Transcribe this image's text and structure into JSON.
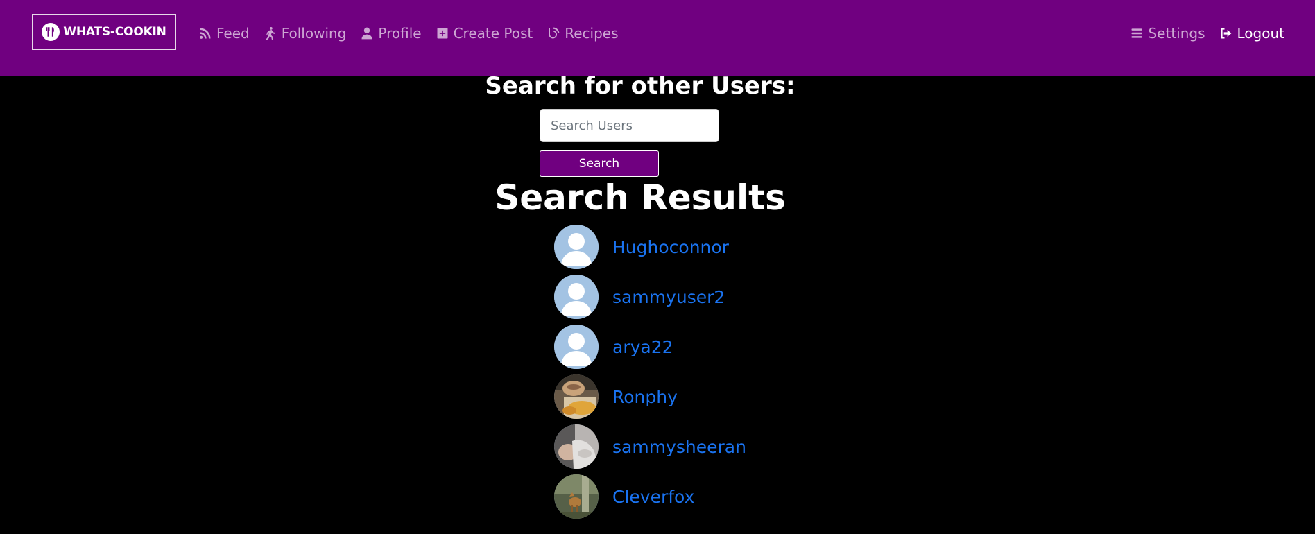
{
  "brand": {
    "logo_text": "WHATS-COOKIN"
  },
  "nav": {
    "left": [
      {
        "label": "Feed",
        "icon": "rss-icon"
      },
      {
        "label": "Following",
        "icon": "walking-icon"
      },
      {
        "label": "Profile",
        "icon": "user-icon"
      },
      {
        "label": "Create Post",
        "icon": "plus-square-icon"
      },
      {
        "label": "Recipes",
        "icon": "blog-icon"
      }
    ],
    "right": [
      {
        "label": "Settings",
        "icon": "bars-icon"
      },
      {
        "label": "Logout",
        "icon": "sign-out-icon"
      }
    ]
  },
  "search": {
    "title": "Search for other Users:",
    "placeholder": "Search Users",
    "value": "",
    "button_label": "Search"
  },
  "results": {
    "title": "Search Results",
    "items": [
      {
        "username": "Hughoconnor",
        "avatar": "default-avatar"
      },
      {
        "username": "sammyuser2",
        "avatar": "default-avatar"
      },
      {
        "username": "arya22",
        "avatar": "default-avatar"
      },
      {
        "username": "Ronphy",
        "avatar": "photo-avatar"
      },
      {
        "username": "sammysheeran",
        "avatar": "photo-avatar"
      },
      {
        "username": "Cleverfox",
        "avatar": "photo-avatar"
      }
    ]
  },
  "colors": {
    "navbar": "#700080",
    "link": "#1a73f0",
    "background": "#000000",
    "default_avatar": "#a3c3e3"
  }
}
